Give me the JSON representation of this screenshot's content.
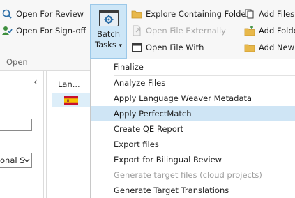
{
  "ribbon": {
    "open_group": {
      "open_for_review": "Open For Review",
      "open_for_signoff": "Open For Sign-off",
      "label": "Open"
    },
    "batch_tasks": {
      "line1": "Batch",
      "line2": "Tasks",
      "arrow": "▾"
    },
    "files_group": {
      "explore_folder": "Explore Containing Folder",
      "open_externally": "Open File Externally",
      "open_with": "Open File With"
    },
    "add_group": {
      "add_files": "Add Files",
      "add_folder": "Add Folde",
      "add_new": "Add New I"
    }
  },
  "left_pane": {
    "collapse_glyph": "‹",
    "dropdown_value": "onal S"
  },
  "mid_pane": {
    "column_header": "Lan..."
  },
  "batch_menu": {
    "items": [
      {
        "label": "Finalize",
        "enabled": true,
        "highlighted": false
      },
      {
        "label": "Analyze Files",
        "enabled": true,
        "highlighted": false
      },
      {
        "label": "Apply Language Weaver Metadata",
        "enabled": true,
        "highlighted": false
      },
      {
        "label": "Apply PerfectMatch",
        "enabled": true,
        "highlighted": true
      },
      {
        "label": "Create QE Report",
        "enabled": true,
        "highlighted": false
      },
      {
        "label": "Export files",
        "enabled": true,
        "highlighted": false
      },
      {
        "label": "Export for Bilingual Review",
        "enabled": true,
        "highlighted": false
      },
      {
        "label": "Generate target files (cloud projects)",
        "enabled": false,
        "highlighted": false
      },
      {
        "label": "Generate Target Translations",
        "enabled": true,
        "highlighted": false
      }
    ]
  },
  "colors": {
    "highlight": "#cfe5f5",
    "batch_button_bg": "#cde6f7",
    "folder_yellow": "#e8b84a",
    "disabled_text": "#a7a7a7"
  }
}
